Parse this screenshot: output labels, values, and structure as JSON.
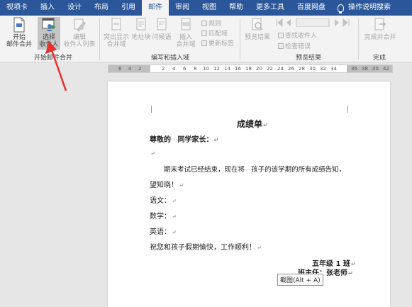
{
  "tabs": [
    "视项卡",
    "插入",
    "设计",
    "布局",
    "引用",
    "邮件",
    "审阅",
    "视图",
    "帮助",
    "更多工具",
    "百度网盘"
  ],
  "active_tab": "邮件",
  "tell_me": "操作说明搜索",
  "ribbon": {
    "start_top": "开始",
    "start_bottom": "邮件合并",
    "select_top": "选择",
    "select_bottom": "收件人",
    "edit_top": "编辑",
    "edit_bottom": "收件人列表",
    "group_start": "开始邮件合并",
    "highlight_top": "突出显示",
    "highlight_bottom": "合并域",
    "address_top": "地址块",
    "greeting_top": "问候语",
    "insert_top": "插入",
    "insert_bottom": "合并域",
    "rules": "规则",
    "match_fields": "匹配域",
    "update_labels": "更新标签",
    "group_write": "编写和插入域",
    "preview_results": "预览结果",
    "find_recipient": "查找收件人",
    "check_errors": "检查错误",
    "group_preview": "预览结果",
    "finish_top": "完成并合并",
    "group_finish": "完成"
  },
  "ruler_numbers": [
    "6",
    "4",
    "2",
    "2",
    "4",
    "6",
    "8",
    "10",
    "12",
    "14",
    "16",
    "18",
    "20",
    "22",
    "24",
    "26",
    "28",
    "30",
    "32",
    "34",
    "36",
    "38",
    "40",
    "42"
  ],
  "document": {
    "title": "成绩单",
    "salutation": "尊敬的",
    "salutation_gap": "···",
    "salutation_end": "同学家长：",
    "body1_a": "期末考试已经结束，现在将",
    "body1_gap": "···",
    "body1_b": "孩子的该学期的所有成绩告知，",
    "body2": "望知晓！",
    "chinese": "语文：",
    "math": "数学：",
    "english": "英语：",
    "wish": "祝您和孩子假期愉快，工作顺利！",
    "class": "五年级 1 班",
    "teacher": "班主任：张老师"
  },
  "tooltip": "截图(Alt + A)",
  "colors": {
    "tab_bar": "#2b579a",
    "arrow": "#e8302c"
  }
}
